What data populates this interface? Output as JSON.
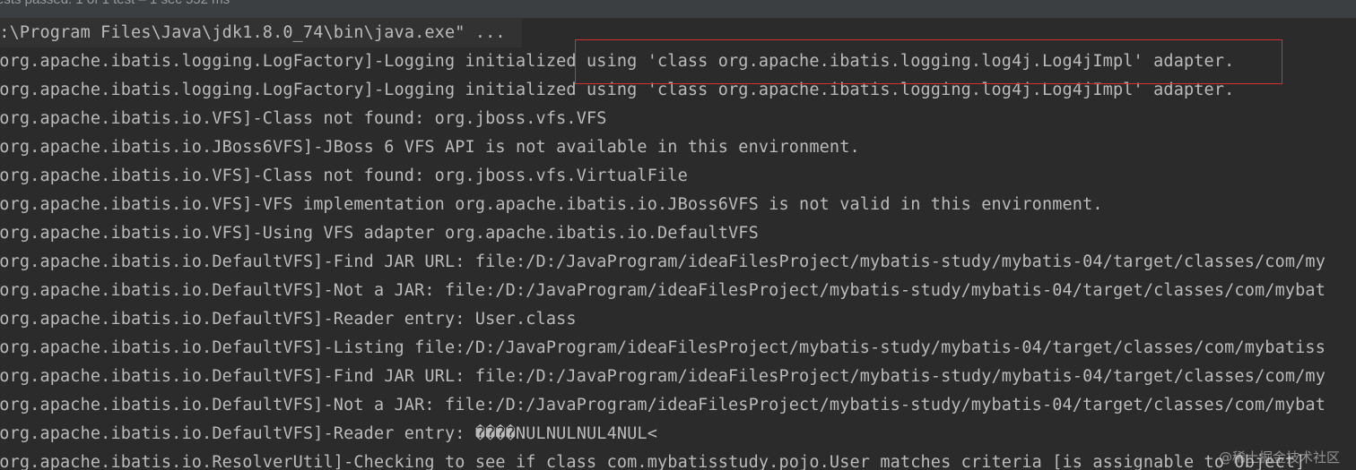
{
  "status_bar": {
    "text": "ests passed: 1 of 1 test – 1 sec 552 ms"
  },
  "console": {
    "command_line": ":\\Program Files\\Java\\jdk1.8.0_74\\bin\\java.exe\" ...",
    "lines": [
      "rg.apache.ibatis.logging.LogFactory]-Logging initialized using 'class org.apache.ibatis.logging.log4j.Log4jImpl' adapter.",
      "rg.apache.ibatis.logging.LogFactory]-Logging initialized using 'class org.apache.ibatis.logging.log4j.Log4jImpl' adapter.",
      "rg.apache.ibatis.io.VFS]-Class not found: org.jboss.vfs.VFS",
      "rg.apache.ibatis.io.JBoss6VFS]-JBoss 6 VFS API is not available in this environment.",
      "rg.apache.ibatis.io.VFS]-Class not found: org.jboss.vfs.VirtualFile",
      "rg.apache.ibatis.io.VFS]-VFS implementation org.apache.ibatis.io.JBoss6VFS is not valid in this environment.",
      "rg.apache.ibatis.io.VFS]-Using VFS adapter org.apache.ibatis.io.DefaultVFS",
      "rg.apache.ibatis.io.DefaultVFS]-Find JAR URL: file:/D:/JavaProgram/ideaFilesProject/mybatis-study/mybatis-04/target/classes/com/my",
      "rg.apache.ibatis.io.DefaultVFS]-Not a JAR: file:/D:/JavaProgram/ideaFilesProject/mybatis-study/mybatis-04/target/classes/com/mybat",
      "rg.apache.ibatis.io.DefaultVFS]-Reader entry: User.class",
      "rg.apache.ibatis.io.DefaultVFS]-Listing file:/D:/JavaProgram/ideaFilesProject/mybatis-study/mybatis-04/target/classes/com/mybatiss",
      "rg.apache.ibatis.io.DefaultVFS]-Find JAR URL: file:/D:/JavaProgram/ideaFilesProject/mybatis-study/mybatis-04/target/classes/com/my",
      "rg.apache.ibatis.io.DefaultVFS]-Not a JAR: file:/D:/JavaProgram/ideaFilesProject/mybatis-study/mybatis-04/target/classes/com/mybat",
      "rg.apache.ibatis.io.DefaultVFS]-Reader entry: ����NULNULNUL4NUL<",
      "rg.apache.ibatis.io.ResolverUtil]-Checking to see if class com.mybatisstudy.pojo.User matches criteria [is assignable to Object]"
    ]
  },
  "watermark": {
    "text": "@稀土掘金技术社区"
  },
  "colors": {
    "background": "#2b2b2b",
    "text": "#bbbbbb",
    "highlight_border": "#d0332e"
  }
}
